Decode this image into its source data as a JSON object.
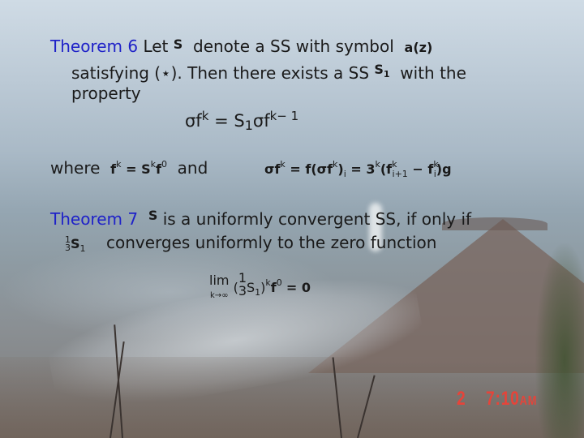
{
  "theorem6": {
    "label": "Theorem 6",
    "line1_a": "Let",
    "line1_sym": "S",
    "line1_b": "denote a SS with symbol",
    "line1_symbol": "a(z)",
    "line2_a": "satisfying (⋆). Then there exists a SS",
    "line2_sym": "S",
    "line2_sym_sub": "1",
    "line2_b": "with the",
    "line3": "property",
    "equation": {
      "lhs": "σf",
      "lhs_sup": "k",
      "eq": "=",
      "rhs_S": "S",
      "rhs_S_sub": "1",
      "rhs_f": "σf",
      "rhs_sup": "k− 1"
    },
    "where_label": "where",
    "where_eq": {
      "f": "f",
      "f_sup": "k",
      "eq": "=",
      "S": "S",
      "S_sup": "k",
      "f0": "f",
      "f0_sup": "0"
    },
    "and_label": "and",
    "diff_eq": {
      "lhs": "σf",
      "lhs_sup": "k",
      "eq1": "= f(σf",
      "mid_sup": "k",
      "mid_close": ")",
      "mid_sub": "i",
      "eq2": "= 3",
      "three_sup": "k",
      "paren_open": "(f",
      "fi1_sup": "k",
      "fi1_sub": "i+1",
      "minus": "−",
      "fi": "f",
      "fi_sup": "k",
      "fi_sub": "i",
      "close": ")g"
    }
  },
  "theorem7": {
    "label": "Theorem 7",
    "sym": "S",
    "line1": "is a uniformly convergent SS, if only if",
    "frac_num": "1",
    "frac_den": "3",
    "S1": "S",
    "S1_sub": "1",
    "line2": "converges uniformly to the zero function",
    "limit": {
      "lim": "lim",
      "lim_sub": "k→∞",
      "open": "(",
      "frac_num": "1",
      "frac_den": "3",
      "S": "S",
      "S_sub": "1",
      "close": ")",
      "k_sup": "k",
      "f": "f",
      "f_sup": "0",
      "eq": "= 0"
    }
  },
  "timestamp": {
    "frame": "2",
    "time": "7:10",
    "ampm": "AM"
  }
}
